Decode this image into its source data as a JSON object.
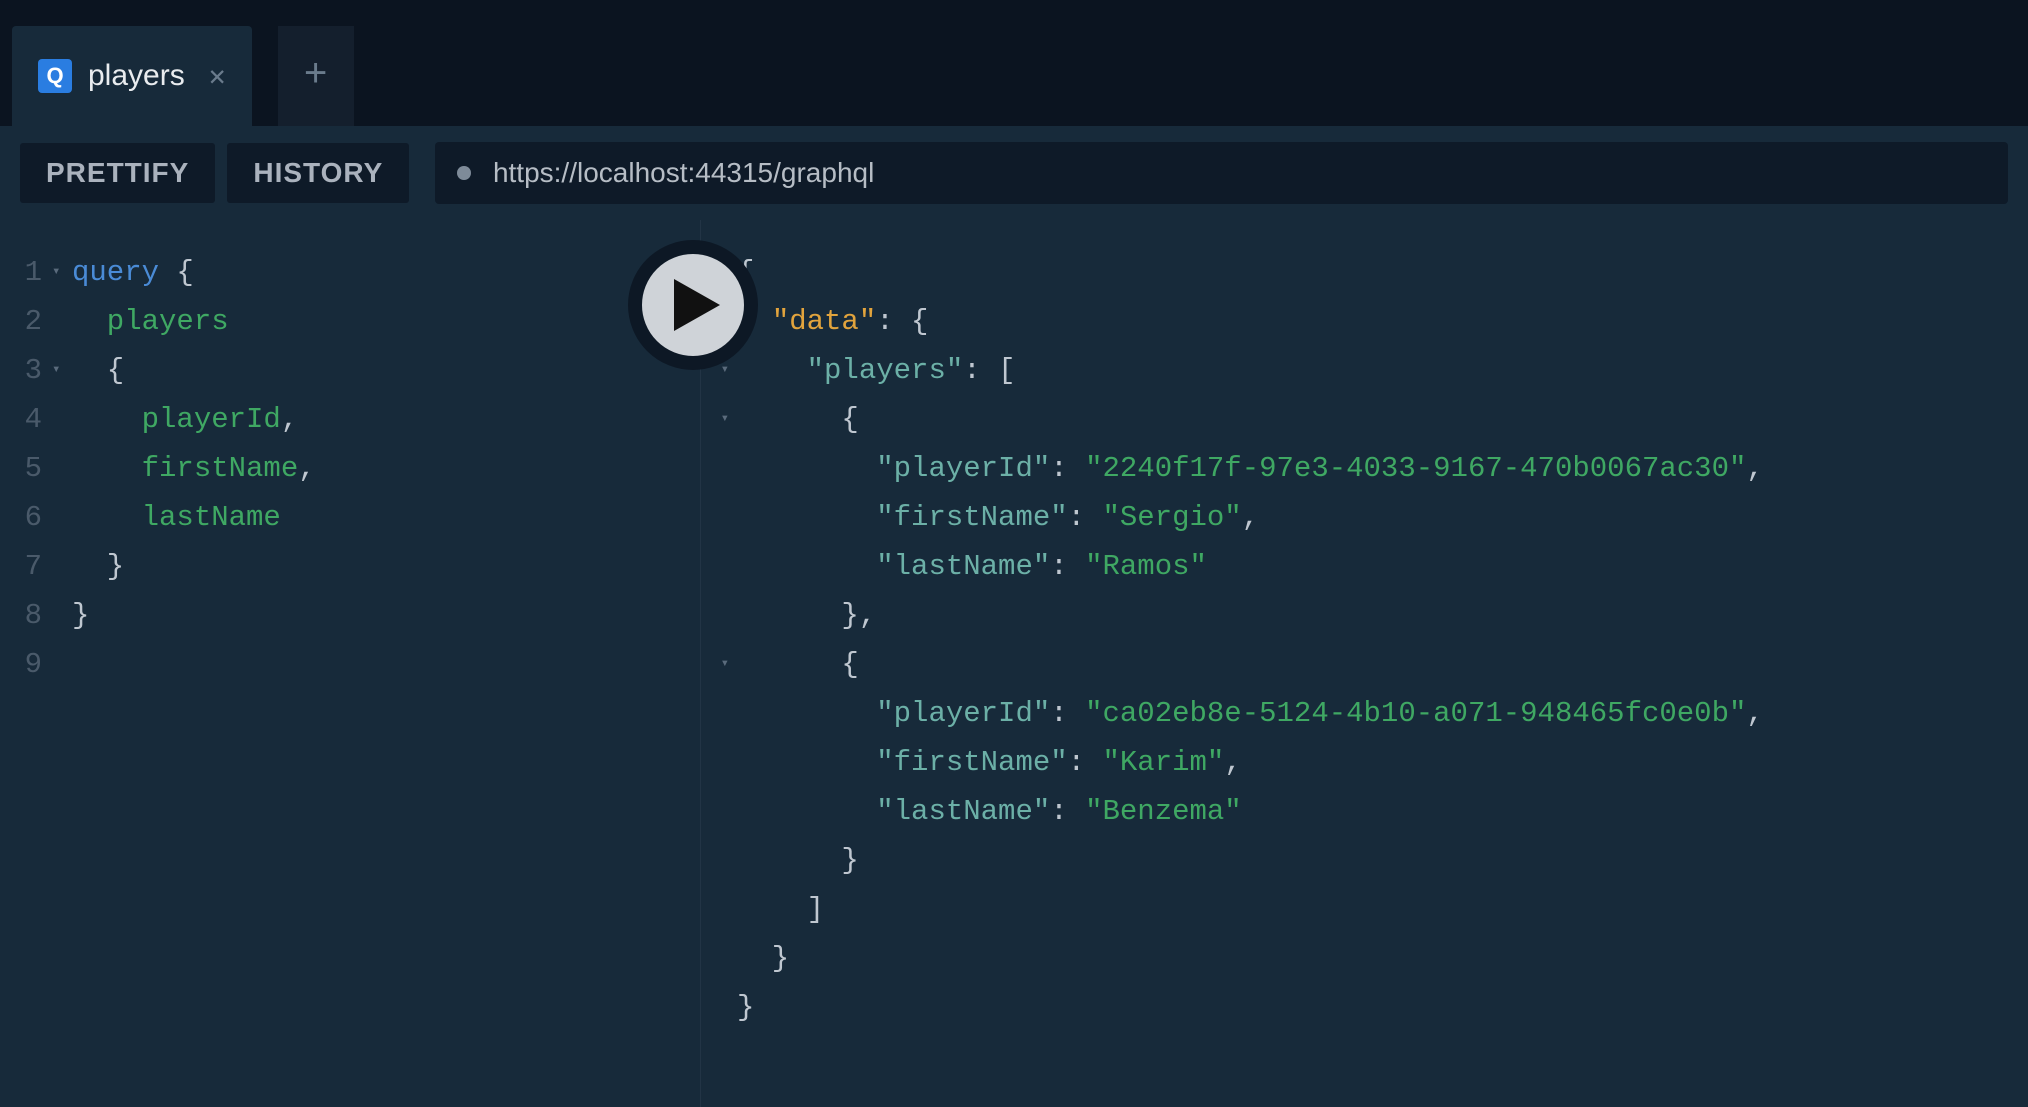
{
  "tabs": {
    "active": {
      "icon_letter": "Q",
      "label": "players"
    }
  },
  "toolbar": {
    "prettify_label": "PRETTIFY",
    "history_label": "HISTORY",
    "endpoint_url": "https://localhost:44315/graphql"
  },
  "query": {
    "lines": [
      {
        "ln": "1",
        "fold": "▾",
        "tokens": [
          {
            "t": "query",
            "c": "keyword"
          },
          {
            "t": " {",
            "c": "punc"
          }
        ]
      },
      {
        "ln": "2",
        "fold": "",
        "tokens": [
          {
            "t": "  players",
            "c": "field"
          }
        ]
      },
      {
        "ln": "3",
        "fold": "▾",
        "tokens": [
          {
            "t": "  {",
            "c": "punc"
          }
        ]
      },
      {
        "ln": "4",
        "fold": "",
        "tokens": [
          {
            "t": "    playerId",
            "c": "field"
          },
          {
            "t": ",",
            "c": "punc"
          }
        ]
      },
      {
        "ln": "5",
        "fold": "",
        "tokens": [
          {
            "t": "    firstName",
            "c": "field"
          },
          {
            "t": ",",
            "c": "punc"
          }
        ]
      },
      {
        "ln": "6",
        "fold": "",
        "tokens": [
          {
            "t": "    lastName",
            "c": "field"
          }
        ]
      },
      {
        "ln": "7",
        "fold": "",
        "tokens": [
          {
            "t": "  }",
            "c": "punc"
          }
        ]
      },
      {
        "ln": "8",
        "fold": "",
        "tokens": [
          {
            "t": "}",
            "c": "punc"
          }
        ]
      },
      {
        "ln": "9",
        "fold": "",
        "tokens": []
      }
    ]
  },
  "result": {
    "lines": [
      {
        "fold": "▾",
        "tokens": [
          {
            "t": "{",
            "c": "punc"
          }
        ]
      },
      {
        "fold": "▾",
        "tokens": [
          {
            "t": "  ",
            "c": "punc"
          },
          {
            "t": "\"data\"",
            "c": "key-root"
          },
          {
            "t": ": {",
            "c": "punc"
          }
        ]
      },
      {
        "fold": "▾",
        "tokens": [
          {
            "t": "    ",
            "c": "punc"
          },
          {
            "t": "\"players\"",
            "c": "key"
          },
          {
            "t": ": [",
            "c": "punc"
          }
        ]
      },
      {
        "fold": "▾",
        "tokens": [
          {
            "t": "      {",
            "c": "punc"
          }
        ]
      },
      {
        "fold": "",
        "tokens": [
          {
            "t": "        ",
            "c": "punc"
          },
          {
            "t": "\"playerId\"",
            "c": "key"
          },
          {
            "t": ": ",
            "c": "punc"
          },
          {
            "t": "\"2240f17f-97e3-4033-9167-470b0067ac30\"",
            "c": "str"
          },
          {
            "t": ",",
            "c": "punc"
          }
        ]
      },
      {
        "fold": "",
        "tokens": [
          {
            "t": "        ",
            "c": "punc"
          },
          {
            "t": "\"firstName\"",
            "c": "key"
          },
          {
            "t": ": ",
            "c": "punc"
          },
          {
            "t": "\"Sergio\"",
            "c": "str"
          },
          {
            "t": ",",
            "c": "punc"
          }
        ]
      },
      {
        "fold": "",
        "tokens": [
          {
            "t": "        ",
            "c": "punc"
          },
          {
            "t": "\"lastName\"",
            "c": "key"
          },
          {
            "t": ": ",
            "c": "punc"
          },
          {
            "t": "\"Ramos\"",
            "c": "str"
          }
        ]
      },
      {
        "fold": "",
        "tokens": [
          {
            "t": "      },",
            "c": "punc"
          }
        ]
      },
      {
        "fold": "▾",
        "tokens": [
          {
            "t": "      {",
            "c": "punc"
          }
        ]
      },
      {
        "fold": "",
        "tokens": [
          {
            "t": "        ",
            "c": "punc"
          },
          {
            "t": "\"playerId\"",
            "c": "key"
          },
          {
            "t": ": ",
            "c": "punc"
          },
          {
            "t": "\"ca02eb8e-5124-4b10-a071-948465fc0e0b\"",
            "c": "str"
          },
          {
            "t": ",",
            "c": "punc"
          }
        ]
      },
      {
        "fold": "",
        "tokens": [
          {
            "t": "        ",
            "c": "punc"
          },
          {
            "t": "\"firstName\"",
            "c": "key"
          },
          {
            "t": ": ",
            "c": "punc"
          },
          {
            "t": "\"Karim\"",
            "c": "str"
          },
          {
            "t": ",",
            "c": "punc"
          }
        ]
      },
      {
        "fold": "",
        "tokens": [
          {
            "t": "        ",
            "c": "punc"
          },
          {
            "t": "\"lastName\"",
            "c": "key"
          },
          {
            "t": ": ",
            "c": "punc"
          },
          {
            "t": "\"Benzema\"",
            "c": "str"
          }
        ]
      },
      {
        "fold": "",
        "tokens": [
          {
            "t": "      }",
            "c": "punc"
          }
        ]
      },
      {
        "fold": "",
        "tokens": [
          {
            "t": "    ]",
            "c": "punc"
          }
        ]
      },
      {
        "fold": "",
        "tokens": [
          {
            "t": "  }",
            "c": "punc"
          }
        ]
      },
      {
        "fold": "",
        "tokens": [
          {
            "t": "}",
            "c": "punc"
          }
        ]
      }
    ]
  }
}
